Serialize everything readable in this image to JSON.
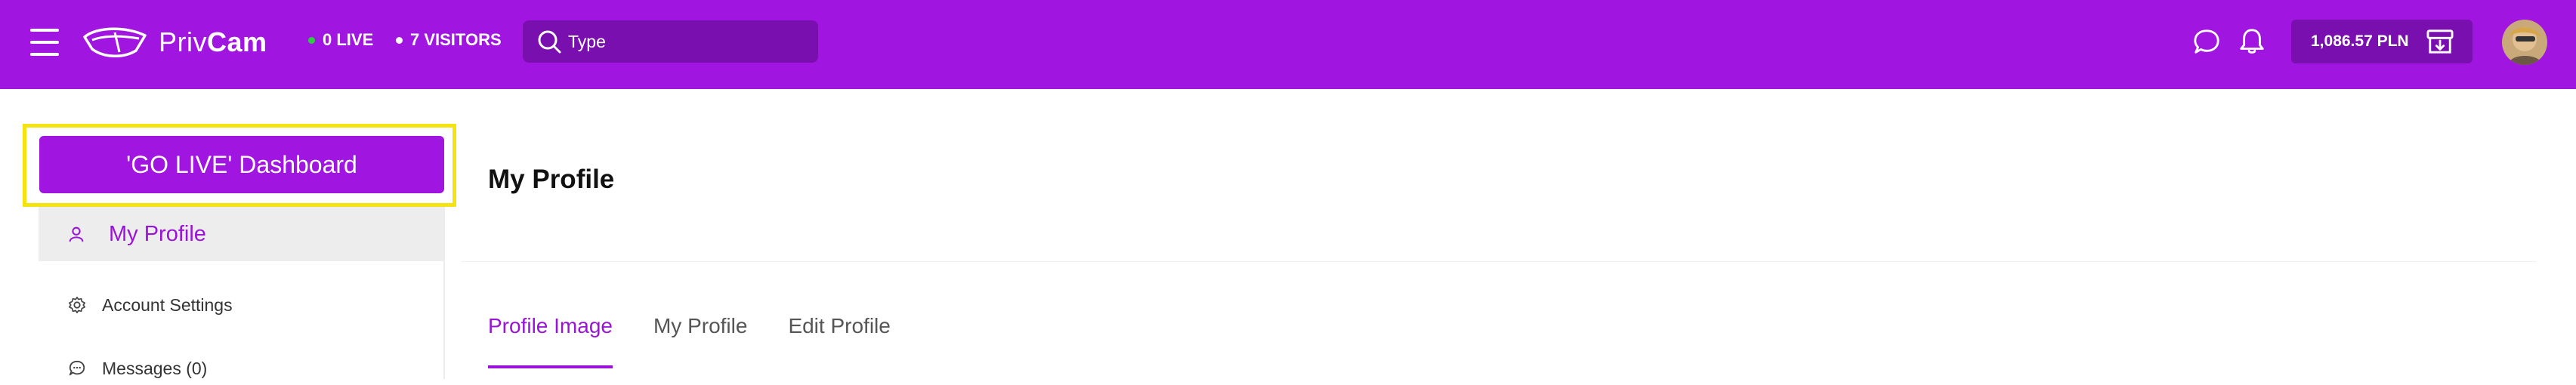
{
  "header": {
    "brand_light": "Priv",
    "brand_bold": "Cam",
    "live_count": "0 LIVE",
    "visitors_count": "7 VISITORS",
    "search_placeholder": "Type",
    "wallet_amount": "1,086.57 PLN",
    "colors": {
      "bar": "#a015e0",
      "live_dot": "#2ecc40",
      "visitors_dot": "#ffffff"
    },
    "icons": [
      "menu-icon",
      "logo-icon",
      "search-icon",
      "chat-icon",
      "bell-icon",
      "wallet-icon"
    ]
  },
  "sidebar": {
    "golive_label": "'GO LIVE' Dashboard",
    "items": [
      {
        "label": "My Profile",
        "icon": "user-icon",
        "active": true
      },
      {
        "label": "Account Settings",
        "icon": "gear-icon"
      },
      {
        "label": "Messages (0)",
        "icon": "message-icon"
      }
    ]
  },
  "main": {
    "title": "My Profile",
    "tabs": [
      {
        "label": "Profile Image",
        "active": true
      },
      {
        "label": "My Profile"
      },
      {
        "label": "Edit Profile"
      }
    ]
  }
}
